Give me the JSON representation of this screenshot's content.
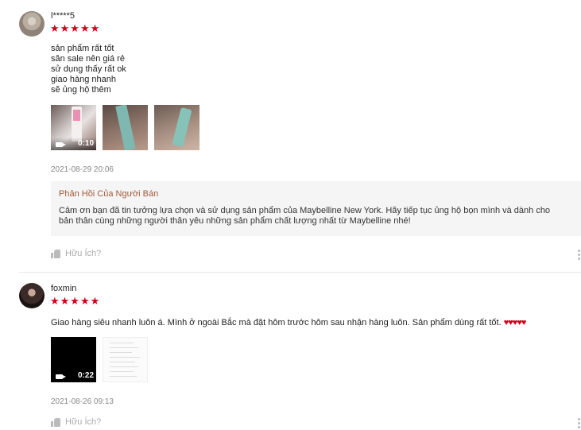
{
  "reviews": [
    {
      "username": "l*****5",
      "stars": "★★★★★",
      "rating": 5,
      "comment_lines": [
        "sản phẩm rất tốt",
        "săn sale nên giá rẻ",
        "sử dụng thấy rất ok",
        "giao hàng nhanh",
        "sẽ ủng hộ thêm"
      ],
      "video_duration": "0:10",
      "date": "2021-08-29 20:06",
      "seller_reply_title": "Phản Hồi Của Người Bán",
      "seller_reply_lines": [
        "Cảm ơn bạn đã tin tưởng lựa chọn và sử dụng sản phẩm của Maybelline New York. Hãy tiếp tục ủng hộ bọn mình và dành cho",
        "bản thân cùng những người thân yêu những sản phẩm chất lượng nhất từ Maybelline nhé!"
      ],
      "helpful_label": "Hữu Ích?"
    },
    {
      "username": "foxmin",
      "stars": "★★★★★",
      "rating": 5,
      "comment": "Giao hàng siêu nhanh luôn á. Mình ở ngoài Bắc mà đặt hôm trước hôm sau nhận hàng luôn. Sản phẩm dùng rất tốt. ",
      "hearts": "♥♥♥♥♥",
      "video_duration": "0:22",
      "date": "2021-08-26 09:13",
      "helpful_label": "Hữu Ích?"
    }
  ],
  "colors": {
    "star": "#d0011b",
    "reply_title": "#a05a3a",
    "reply_bg": "#f5f5f5"
  }
}
